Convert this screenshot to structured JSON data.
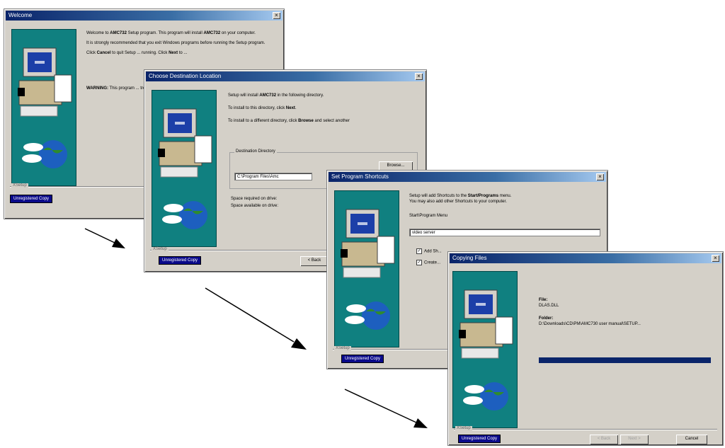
{
  "welcome": {
    "title": "Welcome",
    "text1a": "Welcome to ",
    "text1b": "AMC732",
    "text1c": " Setup program. This program will install ",
    "text1d": "AMC732",
    "text1e": " on your computer.",
    "text2": "It is strongly recommended that you exit Windows programs before running the Setup program.",
    "text3a": "Click ",
    "text3b": "Cancel",
    "text3c": " to quit Setup ... running. Click ",
    "text3d": "Next",
    "text3e": " to ...",
    "text4a": "WARNING:",
    "text4b": " This program ... treaties. Unauthorized ...",
    "setup_label": "XSetup",
    "badge": "Unregistered Copy"
  },
  "destination": {
    "title": "Choose Destination Location",
    "text1a": "Setup will install ",
    "text1b": "AMC732",
    "text1c": " in the following directory.",
    "text2a": "To install to this directory, click ",
    "text2b": "Next",
    "text2c": ".",
    "text3a": "To install to a different directory, click ",
    "text3b": "Browse",
    "text3c": " and select another",
    "group_label": "Destination Directory",
    "path": "C:\\Program Files\\Amc",
    "browse": "Browse...",
    "space_required": "Space required on drive:",
    "space_available": "Space available on drive:",
    "setup_label": "XSetup",
    "badge": "Unregistered Copy",
    "back": "< Back"
  },
  "shortcut": {
    "title": "Set Program Shortcuts",
    "text1a": "Setup will add Shortcuts to the ",
    "text1b": "Start/Programs",
    "text1c": " menu.",
    "text2": "You may also add other Shortcuts to your computer.",
    "menu_label": "Start\\Program Menu",
    "menu_value": "video server",
    "check1": "Add Sh...",
    "check2": "Create...",
    "setup_label": "XSetup",
    "badge": "Unregistered Copy"
  },
  "copying": {
    "title": "Copying Files",
    "file_label": "File:",
    "file_value": "DLAS.DLL",
    "folder_label": "Folder:",
    "folder_value": "D:\\Downloads\\CD\\PM\\AMC730 user manual\\SETUP...",
    "progress": 1.0,
    "setup_label": "XSetup",
    "badge": "Unregistered Copy",
    "back": "< Back",
    "next": "Next >",
    "cancel": "Cancel"
  }
}
